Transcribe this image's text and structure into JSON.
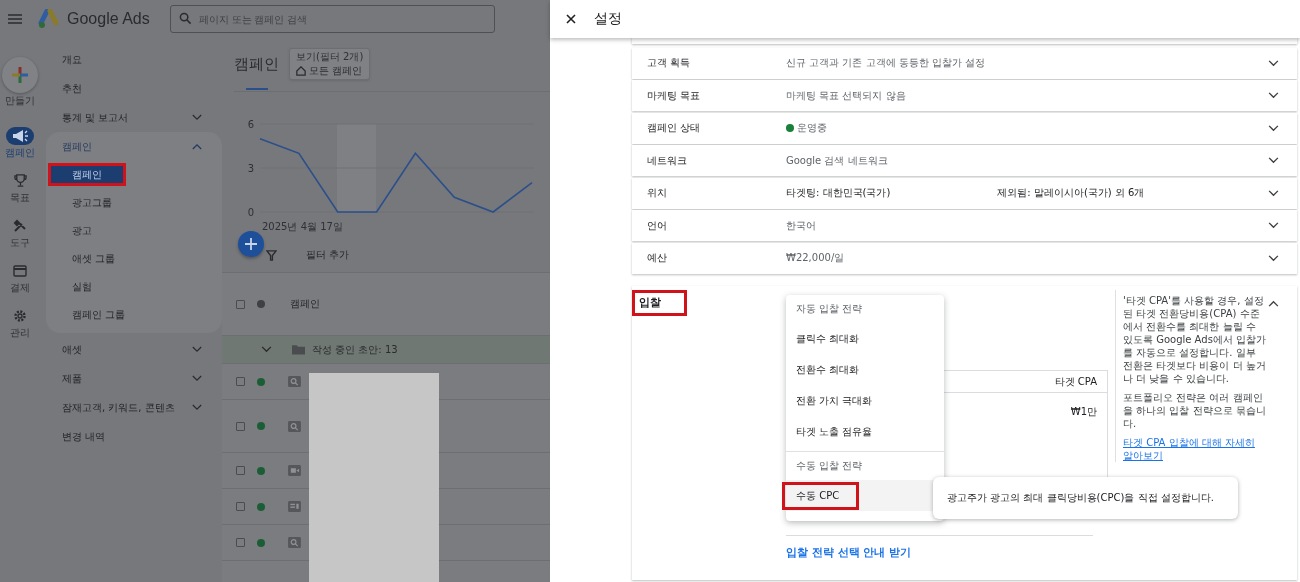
{
  "left_panel": {
    "brand": "Google Ads",
    "search": {
      "placeholder": "페이지 또는 캠페인 검색"
    },
    "rail": [
      {
        "label": "만들기",
        "kind": "create",
        "selected": false
      },
      {
        "label": "캠페인",
        "kind": "campaigns",
        "selected": true
      },
      {
        "label": "목표",
        "kind": "goals",
        "selected": false
      },
      {
        "label": "도구",
        "kind": "tools",
        "selected": false
      },
      {
        "label": "결제",
        "kind": "billing",
        "selected": false
      },
      {
        "label": "관리",
        "kind": "admin",
        "selected": false
      }
    ],
    "nav": [
      {
        "label": "개요",
        "kind": "link"
      },
      {
        "label": "추천",
        "kind": "link"
      },
      {
        "label": "통계 및 보고서",
        "kind": "group",
        "expanded": false
      },
      {
        "label": "캠페인",
        "kind": "group",
        "expanded": true,
        "children": [
          {
            "label": "캠페인",
            "selected": true,
            "highlighted": true
          },
          {
            "label": "광고그룹",
            "selected": false,
            "highlighted": false
          },
          {
            "label": "광고",
            "selected": false,
            "highlighted": false
          },
          {
            "label": "애셋 그룹",
            "selected": false,
            "highlighted": false
          },
          {
            "label": "실험",
            "selected": false,
            "highlighted": false
          },
          {
            "label": "캠페인 그룹",
            "selected": false,
            "highlighted": false
          }
        ]
      },
      {
        "label": "애셋",
        "kind": "group",
        "expanded": false
      },
      {
        "label": "제품",
        "kind": "group",
        "expanded": false
      },
      {
        "label": "잠재고객, 키워드, 콘텐츠",
        "kind": "group",
        "expanded": false
      },
      {
        "label": "변경 내역",
        "kind": "link"
      }
    ],
    "main": {
      "title": "캠페인",
      "view": {
        "caption": "보기(필터 2개)",
        "label": "모든 캠페인"
      },
      "chart_data": {
        "type": "line",
        "xlabel": "2025년 4월 17일",
        "ylim": [
          0,
          6
        ],
        "yticks": [
          0,
          3,
          6
        ],
        "series": [
          {
            "color": "#2b4f8a",
            "values": [
              5,
              4,
              0,
              0,
              4,
              1,
              0,
              2
            ]
          }
        ]
      },
      "filter_label": "필터 추가",
      "table": {
        "header": "캠페인",
        "select_all_checked": false,
        "group": {
          "label": "작성 중인 초안: 13",
          "expanded": true
        },
        "rows": [
          {
            "kind": "search",
            "checked": false
          },
          {
            "kind": "search",
            "checked": false
          },
          {
            "kind": "video",
            "checked": false
          },
          {
            "kind": "display",
            "checked": false
          },
          {
            "kind": "search",
            "checked": false
          }
        ]
      }
    }
  },
  "settings_panel": {
    "title": "설정",
    "rows": [
      {
        "label": "고객 획득",
        "kind": "text",
        "value": "신규 고객과 기존 고객에 동등한 입찰가 설정"
      },
      {
        "label": "마케팅 목표",
        "kind": "text",
        "value": "마케팅 목표 선택되지 않음"
      },
      {
        "label": "캠페인 상태",
        "kind": "status",
        "value": "운영중",
        "color": "#188038"
      },
      {
        "label": "네트워크",
        "kind": "text",
        "value": "Google 검색 네트워크"
      },
      {
        "label": "위치",
        "kind": "location",
        "value": "타겟팅: 대한민국(국가)",
        "excluded": "제외됨: 말레이시아(국가) 외 6개"
      },
      {
        "label": "언어",
        "kind": "text",
        "value": "한국어"
      },
      {
        "label": "예산",
        "kind": "text",
        "value": "₩22,000/일"
      }
    ],
    "bidding": {
      "label": "입찰",
      "highlighted": true,
      "expanded": true,
      "menu": [
        {
          "kind": "header",
          "label": "자동 입찰 전략"
        },
        {
          "kind": "option",
          "label": "클릭수 최대화",
          "selected": false,
          "highlighted": false
        },
        {
          "kind": "option",
          "label": "전환수 최대화",
          "selected": false,
          "highlighted": false
        },
        {
          "kind": "option",
          "label": "전환 가치 극대화",
          "selected": false,
          "highlighted": false
        },
        {
          "kind": "option",
          "label": "타겟 노출 점유율",
          "selected": false,
          "highlighted": false
        },
        {
          "kind": "header",
          "label": "수동 입찰 전략"
        },
        {
          "kind": "option",
          "label": "수동 CPC",
          "selected": true,
          "highlighted": true
        }
      ],
      "table_header": "타겟 CPA",
      "table_value": "₩1만",
      "tooltip": "광고주가 광고의 최대 클릭당비용(CPC)을 직접 설정합니다.",
      "guide_link": "입찰 전략 선택 안내 받기",
      "help": [
        "'타겟 CPA'를 사용할 경우, 설정된 타겟 전환당비용(CPA) 수준에서 전환수를 최대한 늘릴 수 있도록 Google Ads에서 입찰가를 자동으로 설정합니다. 일부 전환은 타겟보다 비용이 더 높거나 더 낮을 수 있습니다.",
        "포트폴리오 전략은 여러 캠페인을 하나의 입찰 전략으로 묶습니다."
      ],
      "help_link": "타겟 CPA 입찰에 대해 자세히 알아보기"
    }
  }
}
